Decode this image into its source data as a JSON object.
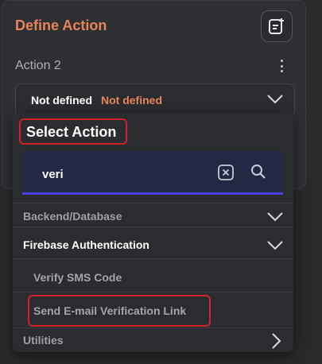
{
  "panel": {
    "title": "Define Action",
    "subtitle": "Action 2",
    "select_value_label": "Not defined",
    "select_value_status": "Not defined"
  },
  "popup": {
    "title": "Select Action",
    "search": {
      "value": "veri"
    },
    "sections": [
      {
        "label": "Backend/Database",
        "expanded": false
      },
      {
        "label": "Firebase Authentication",
        "expanded": true
      },
      {
        "label": "Utilities",
        "expanded": false
      }
    ],
    "items": [
      {
        "label": "Verify SMS Code"
      },
      {
        "label": "Send E-mail Verification Link"
      }
    ]
  },
  "colors": {
    "accent": "#e8855a",
    "highlight": "#d3212b",
    "search_underline": "#4a3fe0",
    "background": "#2a2a2d"
  }
}
